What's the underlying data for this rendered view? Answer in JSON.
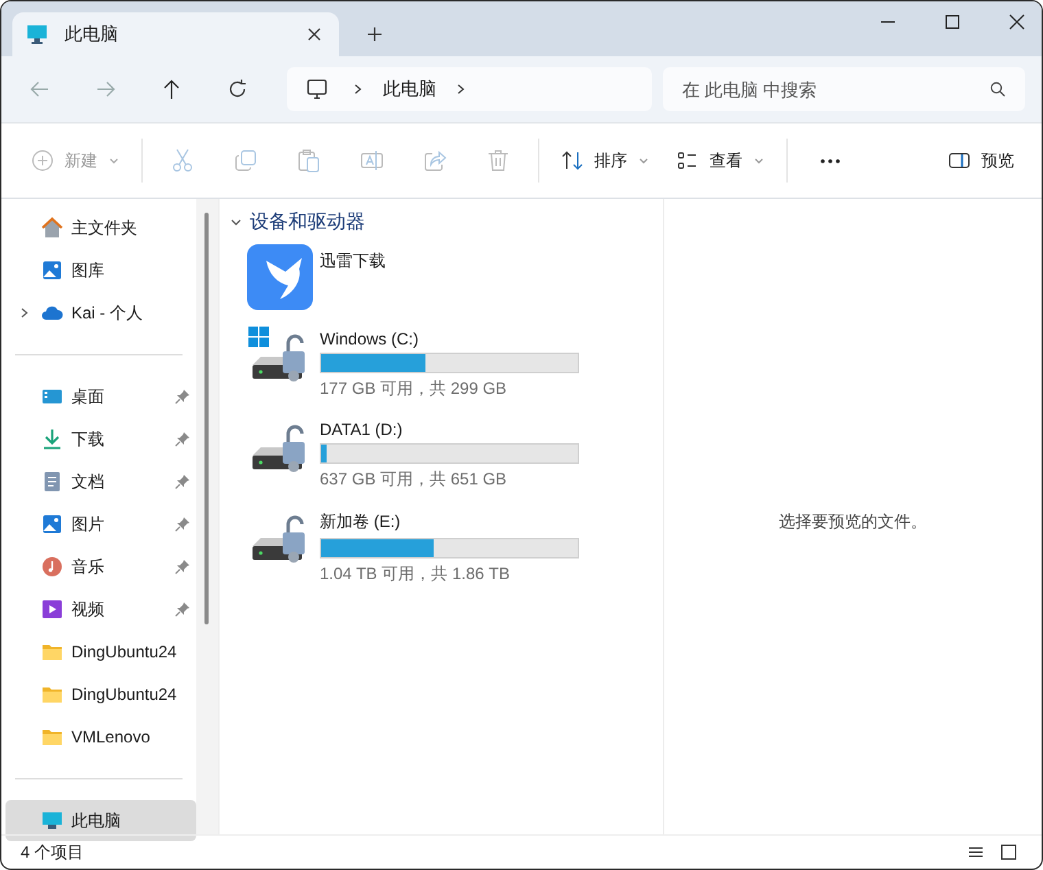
{
  "window": {
    "tab_title": "此电脑"
  },
  "address": {
    "segments": [
      "此电脑"
    ]
  },
  "search": {
    "placeholder": "在 此电脑 中搜索"
  },
  "toolbar": {
    "new": {
      "label": "新建",
      "disabled": true
    },
    "actions": [
      {
        "kind": "cut",
        "disabled": true
      },
      {
        "kind": "copy",
        "disabled": true
      },
      {
        "kind": "paste",
        "disabled": true
      },
      {
        "kind": "rename",
        "disabled": true
      },
      {
        "kind": "share",
        "disabled": true
      },
      {
        "kind": "delete",
        "disabled": true
      }
    ],
    "sort": {
      "label": "排序"
    },
    "view": {
      "label": "查看"
    },
    "preview": {
      "label": "预览"
    }
  },
  "sidebar": {
    "groups": [
      [
        {
          "label": "主文件夹",
          "kind": "home",
          "pinned": false,
          "expandable": false,
          "selected": false
        },
        {
          "label": "图库",
          "kind": "gallery",
          "pinned": false,
          "expandable": false,
          "selected": false
        },
        {
          "label": "Kai - 个人",
          "kind": "cloud",
          "pinned": false,
          "expandable": true,
          "selected": false
        }
      ],
      [
        {
          "label": "桌面",
          "kind": "desktop",
          "pinned": true,
          "expandable": false,
          "selected": false
        },
        {
          "label": "下载",
          "kind": "download",
          "pinned": true,
          "expandable": false,
          "selected": false
        },
        {
          "label": "文档",
          "kind": "docs",
          "pinned": true,
          "expandable": false,
          "selected": false
        },
        {
          "label": "图片",
          "kind": "pictures",
          "pinned": true,
          "expandable": false,
          "selected": false
        },
        {
          "label": "音乐",
          "kind": "music",
          "pinned": true,
          "expandable": false,
          "selected": false
        },
        {
          "label": "视频",
          "kind": "video",
          "pinned": true,
          "expandable": false,
          "selected": false
        },
        {
          "label": "DingUbuntu24",
          "kind": "folder",
          "pinned": false,
          "expandable": false,
          "selected": false
        },
        {
          "label": "DingUbuntu24",
          "kind": "folder",
          "pinned": false,
          "expandable": false,
          "selected": false
        },
        {
          "label": "VMLenovo",
          "kind": "folder",
          "pinned": false,
          "expandable": false,
          "selected": false
        }
      ],
      [
        {
          "label": "此电脑",
          "kind": "pc",
          "pinned": false,
          "expandable": false,
          "selected": true
        }
      ]
    ]
  },
  "content": {
    "section": {
      "title": "设备和驱动器",
      "expanded": true
    },
    "items": [
      {
        "kind": "app",
        "name": "迅雷下载"
      },
      {
        "kind": "drive",
        "name": "Windows (C:)",
        "system": true,
        "level": 0.408,
        "space": "177 GB 可用，共 299 GB"
      },
      {
        "kind": "drive",
        "name": "DATA1 (D:)",
        "system": false,
        "level": 0.022,
        "space": "637 GB 可用，共 651 GB"
      },
      {
        "kind": "drive",
        "name": "新加卷 (E:)",
        "system": false,
        "level": 0.44,
        "space": "1.04 TB 可用，共 1.86 TB"
      }
    ]
  },
  "preview_pane": {
    "message": "选择要预览的文件。"
  },
  "status_bar": {
    "count": "4 个项目"
  }
}
